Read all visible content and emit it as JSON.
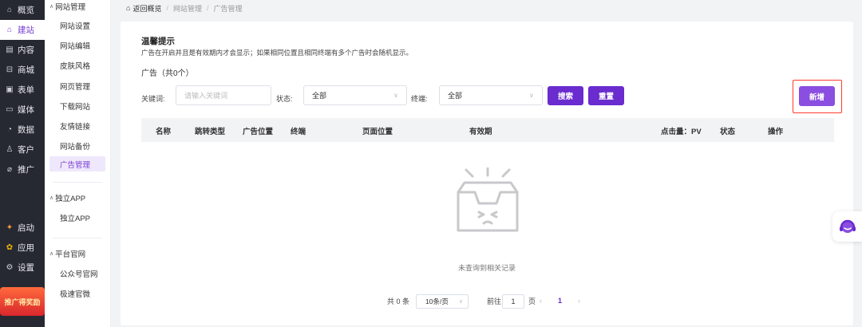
{
  "main_nav": [
    {
      "icon": "storefront-icon",
      "label": "概览",
      "active": false
    },
    {
      "icon": "home-icon",
      "label": "建站",
      "active": true
    },
    {
      "icon": "document-icon",
      "label": "内容",
      "active": false
    },
    {
      "icon": "store-icon",
      "label": "商城",
      "active": false
    },
    {
      "icon": "form-icon",
      "label": "表单",
      "active": false
    },
    {
      "icon": "video-icon",
      "label": "媒体",
      "active": false
    },
    {
      "icon": "chart-icon",
      "label": "数据",
      "active": false
    },
    {
      "icon": "user-icon",
      "label": "客户",
      "active": false
    },
    {
      "icon": "paperclip-icon",
      "label": "推广",
      "active": false
    }
  ],
  "main_nav_bottom": [
    {
      "icon": "launch-icon",
      "label": "启动"
    },
    {
      "icon": "apps-icon",
      "label": "应用"
    },
    {
      "icon": "settings-icon",
      "label": "设置"
    }
  ],
  "promo_text": "推广得奖励",
  "sub_nav": {
    "groups": [
      {
        "title": "网站管理",
        "items": [
          "网站设置",
          "网站编辑",
          "皮肤风格",
          "网页管理",
          "下载网站",
          "友情链接",
          "网站备份",
          "广告管理"
        ],
        "active": "广告管理"
      },
      {
        "title": "独立APP",
        "items": [
          "独立APP"
        ]
      },
      {
        "title": "平台官网",
        "items": [
          "公众号官网",
          "极速官微"
        ]
      }
    ]
  },
  "breadcrumb": {
    "home": "返回概览",
    "items": [
      "网站管理",
      "广告管理"
    ],
    "separator": "/"
  },
  "tip": {
    "title": "温馨提示",
    "text": "广告在开启并且是有效期内才会显示；如果相同位置且相同终端有多个广告时会随机显示。"
  },
  "count_label": "广告（共0个）",
  "filters": {
    "keyword_label": "关键词:",
    "keyword_placeholder": "请输入关键词",
    "status_label": "状态:",
    "status_value": "全部",
    "terminal_label": "终端:",
    "terminal_value": "全部",
    "search_btn": "搜索",
    "reset_btn": "重置",
    "add_btn": "新增"
  },
  "table": {
    "columns": [
      "名称",
      "跳转类型",
      "广告位置",
      "终端",
      "页面位置",
      "有效期",
      "点击量：PV",
      "状态",
      "操作"
    ],
    "rows": []
  },
  "empty_text": "未查询到相关记录",
  "pagination": {
    "total": "共 0 条",
    "page_size": "10条/页",
    "goto_label": "前往",
    "goto_value": "1",
    "page_label": "页",
    "prev": "‹",
    "current": "1",
    "next": "›"
  },
  "colors": {
    "primary": "#6a2bcf",
    "add_button": "#8a4ee0",
    "highlight_frame": "#ff3b2f",
    "sidebar": "#262932"
  }
}
